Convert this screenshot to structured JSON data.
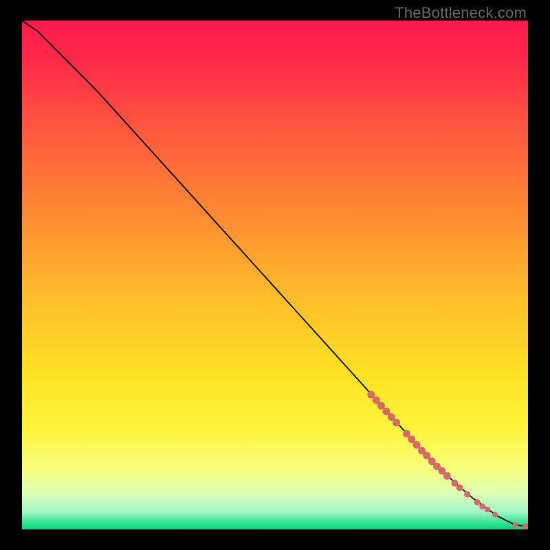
{
  "watermark": "TheBottleneck.com",
  "chart_data": {
    "type": "line",
    "title": "",
    "xlabel": "",
    "ylabel": "",
    "xlim": [
      0,
      100
    ],
    "ylim": [
      0,
      100
    ],
    "grid": false,
    "legend": false,
    "background_gradient_stops": [
      {
        "pos": 0.0,
        "color": "#ff1a4b"
      },
      {
        "pos": 0.08,
        "color": "#ff2a49"
      },
      {
        "pos": 0.22,
        "color": "#ff5a3e"
      },
      {
        "pos": 0.38,
        "color": "#ff8a33"
      },
      {
        "pos": 0.55,
        "color": "#ffbf2a"
      },
      {
        "pos": 0.7,
        "color": "#ffe324"
      },
      {
        "pos": 0.8,
        "color": "#fff43a"
      },
      {
        "pos": 0.88,
        "color": "#f7ff7a"
      },
      {
        "pos": 0.93,
        "color": "#dcffb4"
      },
      {
        "pos": 0.965,
        "color": "#a3f7c8"
      },
      {
        "pos": 0.985,
        "color": "#3de59a"
      },
      {
        "pos": 1.0,
        "color": "#06d67a"
      }
    ],
    "series": [
      {
        "name": "curve",
        "x": [
          0,
          3,
          6,
          10,
          15,
          20,
          25,
          30,
          35,
          40,
          45,
          50,
          55,
          60,
          65,
          70,
          75,
          80,
          83,
          86,
          89,
          92,
          94,
          96,
          97,
          98,
          100
        ],
        "y": [
          100,
          98,
          95,
          91,
          86,
          80.5,
          75,
          69.5,
          64,
          58.5,
          53,
          47.5,
          42,
          36.5,
          31,
          25.5,
          20,
          14.5,
          11.5,
          8.8,
          6.2,
          4.0,
          2.6,
          1.6,
          1.1,
          0.8,
          0.6
        ]
      }
    ],
    "markers": {
      "color": "#d46a6a",
      "points": [
        {
          "x": 69.0,
          "y": 26.5,
          "r": 5.5
        },
        {
          "x": 70.0,
          "y": 25.4,
          "r": 5.5
        },
        {
          "x": 71.0,
          "y": 24.3,
          "r": 5.5
        },
        {
          "x": 72.0,
          "y": 23.2,
          "r": 5.5
        },
        {
          "x": 73.0,
          "y": 22.1,
          "r": 5.5
        },
        {
          "x": 74.0,
          "y": 21.0,
          "r": 5.5
        },
        {
          "x": 76.0,
          "y": 18.8,
          "r": 5.5
        },
        {
          "x": 77.0,
          "y": 17.7,
          "r": 5.5
        },
        {
          "x": 78.0,
          "y": 16.6,
          "r": 5.5
        },
        {
          "x": 79.0,
          "y": 15.5,
          "r": 5.5
        },
        {
          "x": 80.0,
          "y": 14.5,
          "r": 5.5
        },
        {
          "x": 81.0,
          "y": 13.4,
          "r": 5.5
        },
        {
          "x": 82.0,
          "y": 12.4,
          "r": 5.5
        },
        {
          "x": 83.0,
          "y": 11.5,
          "r": 5.5
        },
        {
          "x": 84.0,
          "y": 10.5,
          "r": 5.5
        },
        {
          "x": 85.5,
          "y": 9.1,
          "r": 5.0
        },
        {
          "x": 86.5,
          "y": 8.2,
          "r": 5.0
        },
        {
          "x": 88.0,
          "y": 6.9,
          "r": 4.6
        },
        {
          "x": 90.0,
          "y": 5.3,
          "r": 4.6
        },
        {
          "x": 91.0,
          "y": 4.5,
          "r": 4.4
        },
        {
          "x": 92.0,
          "y": 3.9,
          "r": 4.2
        },
        {
          "x": 93.5,
          "y": 2.9,
          "r": 4.0
        },
        {
          "x": 97.5,
          "y": 0.9,
          "r": 4.2
        },
        {
          "x": 99.5,
          "y": 0.6,
          "r": 4.4
        },
        {
          "x": 100.0,
          "y": 0.6,
          "r": 4.6
        }
      ]
    }
  }
}
